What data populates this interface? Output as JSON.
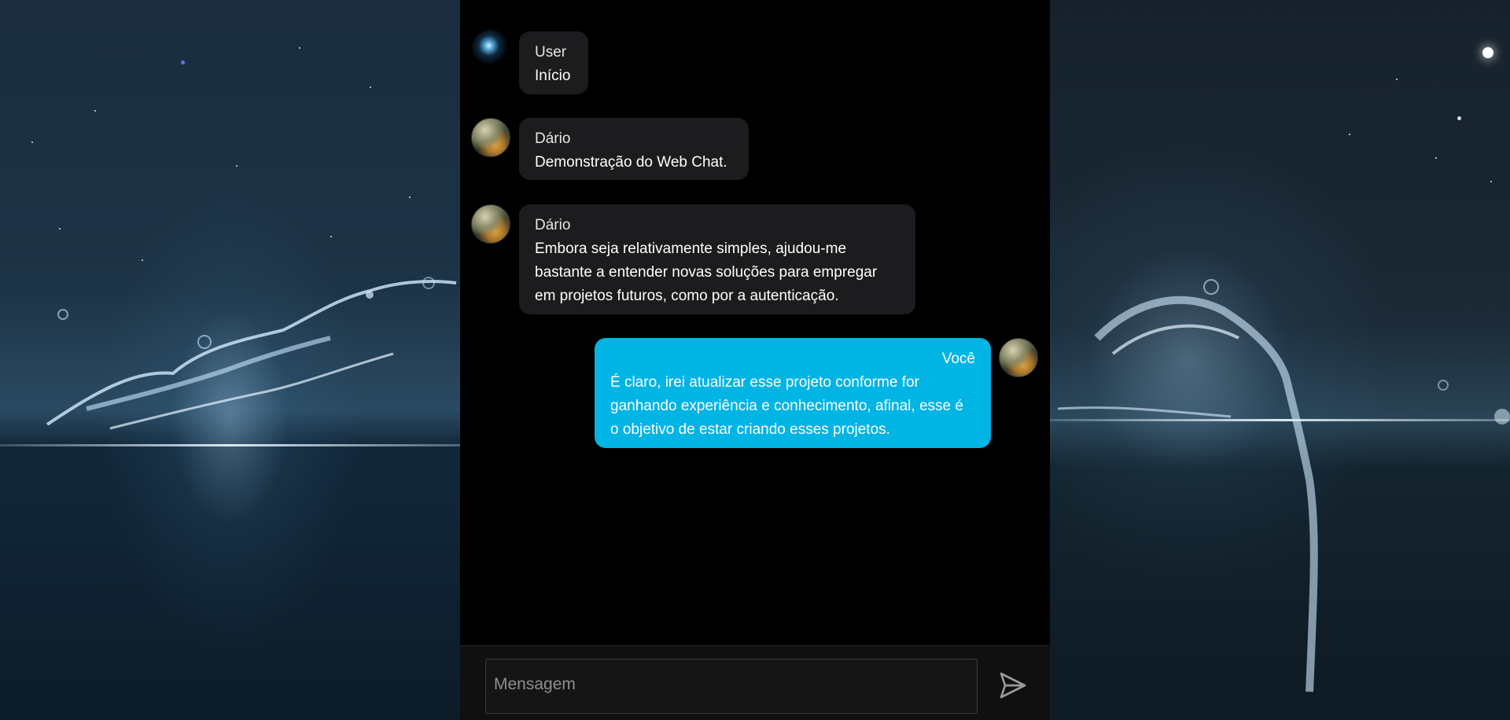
{
  "messages": [
    {
      "sender": "User",
      "text": "Início",
      "side": "left",
      "avatar": "space-avatar"
    },
    {
      "sender": "Dário",
      "text": "Demonstração do Web Chat.",
      "side": "left",
      "avatar": "photo-avatar"
    },
    {
      "sender": "Dário",
      "text": "Embora seja relativamente simples, ajudou-me bastante a entender novas soluções para empregar em projetos futuros, como por a autenticação.",
      "side": "left",
      "avatar": "photo-avatar"
    },
    {
      "sender": "Você",
      "text": "É claro, irei atualizar esse projeto conforme for ganhando experiência e conhecimento, afinal, esse é o objetivo de estar criando esses projetos.",
      "side": "right",
      "avatar": "photo-avatar"
    }
  ],
  "composer": {
    "placeholder": "Mensagem",
    "send_icon": "send-icon"
  },
  "colors": {
    "chat_background": "#000000",
    "other_bubble": "#1c1c1e",
    "own_bubble": "#00b4e4",
    "composer_background": "#101010"
  }
}
